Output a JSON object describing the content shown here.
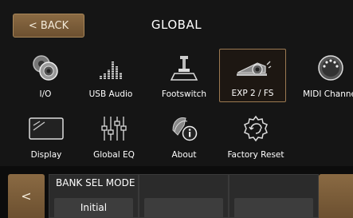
{
  "header": {
    "back_label": "< BACK",
    "title": "GLOBAL"
  },
  "menu": {
    "items": [
      {
        "label": "I/O",
        "icon": "io-icon",
        "selected": false
      },
      {
        "label": "USB Audio",
        "icon": "usb-audio-icon",
        "selected": false
      },
      {
        "label": "Footswitch",
        "icon": "footswitch-icon",
        "selected": false
      },
      {
        "label": "EXP 2 / FS",
        "icon": "expression-pedal-icon",
        "selected": true
      },
      {
        "label": "MIDI Channel",
        "icon": "midi-port-icon",
        "selected": false
      },
      {
        "label": "Display",
        "icon": "display-icon",
        "selected": false
      },
      {
        "label": "Global EQ",
        "icon": "eq-sliders-icon",
        "selected": false
      },
      {
        "label": "About",
        "icon": "about-info-icon",
        "selected": false
      },
      {
        "label": "Factory Reset",
        "icon": "factory-reset-icon",
        "selected": false
      }
    ]
  },
  "footer": {
    "prev_label": "<",
    "params": [
      {
        "title": "BANK SEL MODE",
        "value": "Initial"
      },
      {
        "title": "",
        "value": ""
      },
      {
        "title": "",
        "value": ""
      }
    ]
  },
  "colors": {
    "accent": "#7a5b38",
    "accent_border": "#9c7a52",
    "background": "#151515"
  }
}
